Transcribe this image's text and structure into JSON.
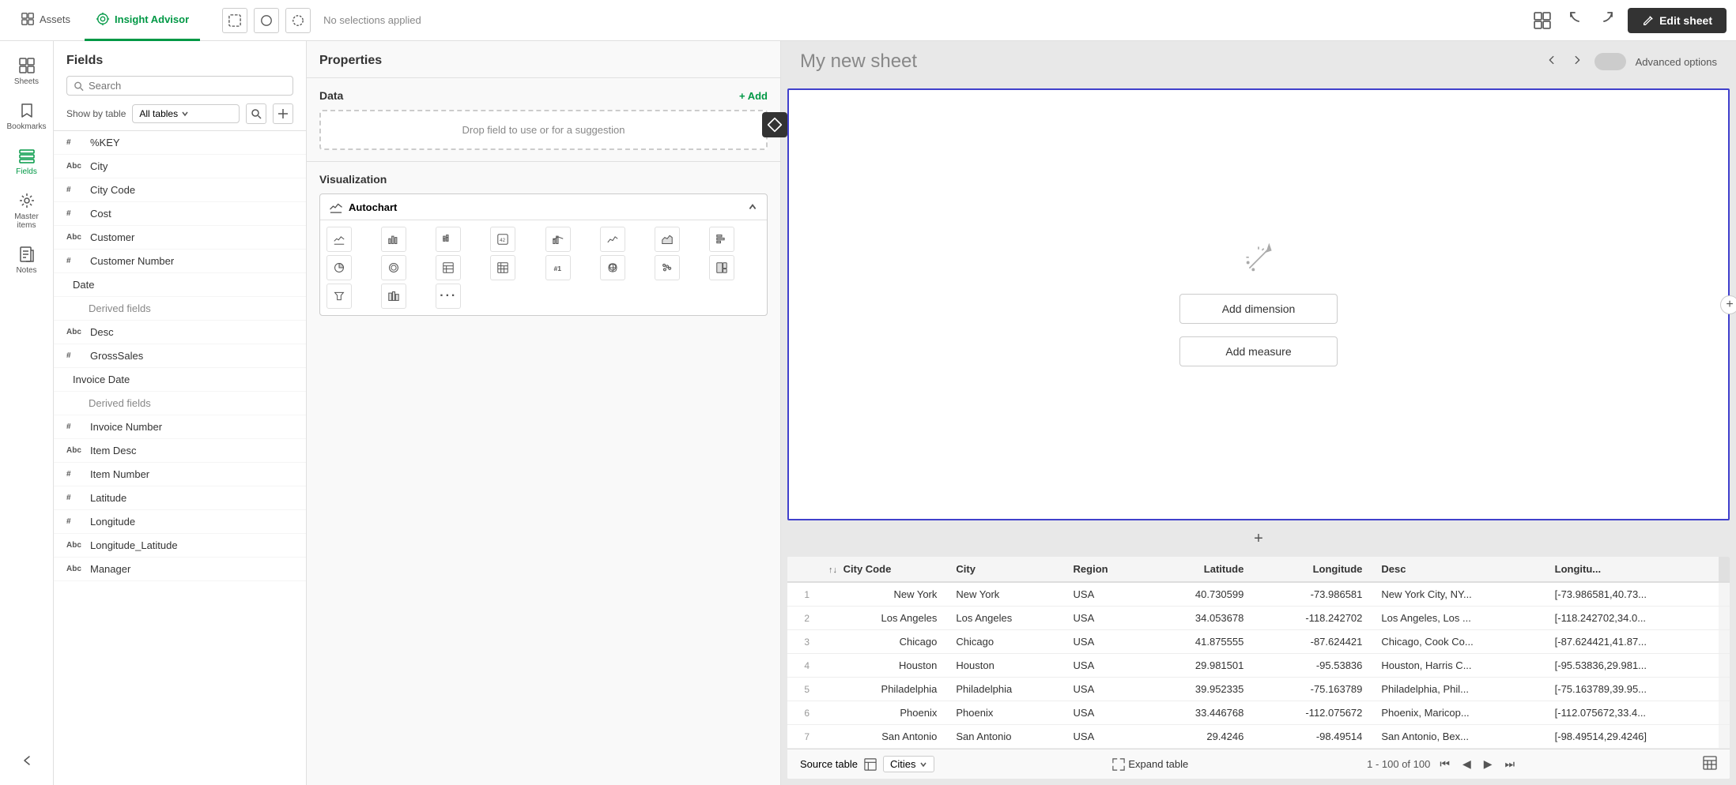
{
  "topbar": {
    "tabs": [
      {
        "id": "assets",
        "label": "Assets",
        "active": false
      },
      {
        "id": "insight-advisor",
        "label": "Insight Advisor",
        "active": true
      }
    ],
    "no_selection": "No selections applied",
    "edit_button": "Edit sheet",
    "undo_icon": "↩",
    "redo_icon": "↪"
  },
  "sidebar": {
    "items": [
      {
        "id": "sheets",
        "label": "Sheets",
        "icon": "grid"
      },
      {
        "id": "bookmarks",
        "label": "Bookmarks",
        "icon": "bookmark"
      },
      {
        "id": "fields",
        "label": "Fields",
        "icon": "fields",
        "active": true
      },
      {
        "id": "master-items",
        "label": "Master items",
        "icon": "master"
      },
      {
        "id": "notes",
        "label": "Notes",
        "icon": "notes"
      }
    ],
    "back_icon": "←"
  },
  "fields_panel": {
    "title": "Fields",
    "search_placeholder": "Search",
    "show_by_label": "Show by table",
    "dropdown_value": "All tables",
    "fields": [
      {
        "type": "#",
        "name": "%KEY"
      },
      {
        "type": "Abc",
        "name": "City"
      },
      {
        "type": "#",
        "name": "City Code"
      },
      {
        "type": "#",
        "name": "Cost"
      },
      {
        "type": "Abc",
        "name": "Customer"
      },
      {
        "type": "#",
        "name": "Customer Number"
      },
      {
        "type": "cal",
        "name": "Date"
      },
      {
        "type": "sub",
        "name": "Derived fields"
      },
      {
        "type": "Abc",
        "name": "Desc"
      },
      {
        "type": "#",
        "name": "GrossSales"
      },
      {
        "type": "cal",
        "name": "Invoice Date"
      },
      {
        "type": "sub",
        "name": "Derived fields"
      },
      {
        "type": "#",
        "name": "Invoice Number"
      },
      {
        "type": "Abc",
        "name": "Item Desc"
      },
      {
        "type": "#",
        "name": "Item Number"
      },
      {
        "type": "#",
        "name": "Latitude"
      },
      {
        "type": "#",
        "name": "Longitude"
      },
      {
        "type": "Abc",
        "name": "Longitude_Latitude"
      },
      {
        "type": "Abc",
        "name": "Manager"
      }
    ]
  },
  "properties_panel": {
    "title": "Properties",
    "data_label": "Data",
    "add_label": "+ Add",
    "drop_zone_text": "Drop field to use or for a suggestion",
    "viz_label": "Visualization",
    "autochart_label": "Autochart"
  },
  "sheet": {
    "title": "My new sheet",
    "add_viz_label": "+",
    "advanced_options": "Advanced options"
  },
  "chart_panel": {
    "add_dimension": "Add dimension",
    "add_measure": "Add measure"
  },
  "table": {
    "columns": [
      {
        "id": "city-code",
        "label": "City Code",
        "sort": true
      },
      {
        "id": "city",
        "label": "City"
      },
      {
        "id": "region",
        "label": "Region"
      },
      {
        "id": "latitude",
        "label": "Latitude"
      },
      {
        "id": "longitude",
        "label": "Longitude"
      },
      {
        "id": "desc",
        "label": "Desc"
      },
      {
        "id": "longitu",
        "label": "Longitu..."
      }
    ],
    "rows": [
      {
        "num": 1,
        "city_code": "New York",
        "city": "New York",
        "region": "USA",
        "latitude": "40.730599",
        "longitude": "-73.986581",
        "desc": "New York City, NY...",
        "longitu": "[-73.986581,40.73..."
      },
      {
        "num": 2,
        "city_code": "Los Angeles",
        "city": "Los Angeles",
        "region": "USA",
        "latitude": "34.053678",
        "longitude": "-118.242702",
        "desc": "Los Angeles, Los ...",
        "longitu": "[-118.242702,34.0..."
      },
      {
        "num": 3,
        "city_code": "Chicago",
        "city": "Chicago",
        "region": "USA",
        "latitude": "41.875555",
        "longitude": "-87.624421",
        "desc": "Chicago, Cook Co...",
        "longitu": "[-87.624421,41.87..."
      },
      {
        "num": 4,
        "city_code": "Houston",
        "city": "Houston",
        "region": "USA",
        "latitude": "29.981501",
        "longitude": "-95.53836",
        "desc": "Houston, Harris C...",
        "longitu": "[-95.53836,29.981..."
      },
      {
        "num": 5,
        "city_code": "Philadelphia",
        "city": "Philadelphia",
        "region": "USA",
        "latitude": "39.952335",
        "longitude": "-75.163789",
        "desc": "Philadelphia, Phil...",
        "longitu": "[-75.163789,39.95..."
      },
      {
        "num": 6,
        "city_code": "Phoenix",
        "city": "Phoenix",
        "region": "USA",
        "latitude": "33.446768",
        "longitude": "-112.075672",
        "desc": "Phoenix, Maricop...",
        "longitu": "[-112.075672,33.4..."
      },
      {
        "num": 7,
        "city_code": "San Antonio",
        "city": "San Antonio",
        "region": "USA",
        "latitude": "29.4246",
        "longitude": "-98.49514",
        "desc": "San Antonio, Bex...",
        "longitu": "[-98.49514,29.4246]"
      }
    ],
    "source_table_label": "Source table",
    "source_table_value": "Cities",
    "expand_label": "Expand table",
    "pagination": "1 - 100 of 100"
  }
}
